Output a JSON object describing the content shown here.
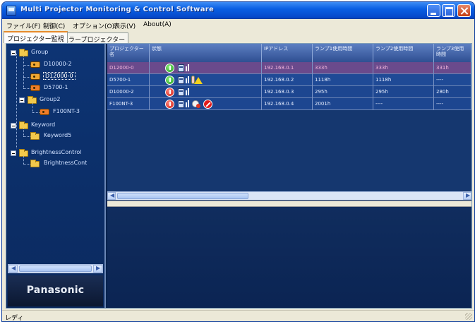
{
  "window": {
    "title": "Multi Projector Monitoring & Control Software"
  },
  "menu": [
    {
      "label": "ファイル(F)"
    },
    {
      "label": "制御(C)"
    },
    {
      "label": "オプション(O)"
    },
    {
      "label": "表示(V)"
    },
    {
      "label": "About(A)"
    }
  ],
  "tabs": [
    {
      "label": "プロジェクター監視",
      "active": true
    },
    {
      "label": "エラープロジェクター",
      "active": false
    }
  ],
  "tree": {
    "group_label": "Group",
    "items": [
      {
        "label": "D10000-2"
      },
      {
        "label": "D12000-0"
      },
      {
        "label": "D5700-1"
      }
    ],
    "group2_label": "Group2",
    "group2_items": [
      {
        "label": "F100NT-3"
      }
    ],
    "keyword_label": "Keyword",
    "keyword_items": [
      {
        "label": "Keyword5"
      }
    ],
    "brightness_label": "BrightnessControl",
    "brightness_items": [
      {
        "label": "BrightnessCont"
      }
    ]
  },
  "brand": {
    "text": "Panasonic"
  },
  "grid": {
    "columns": [
      {
        "label": "プロジェクター名"
      },
      {
        "label": "状態"
      },
      {
        "label": "IPアドレス"
      },
      {
        "label": "ランプ1使用時間"
      },
      {
        "label": "ランプ2使用時間"
      },
      {
        "label": "ランプ3使用時間"
      }
    ],
    "rows": [
      {
        "name": "D12000-0",
        "ip": "192.168.0.1",
        "lamp1": "333h",
        "lamp2": "333h",
        "lamp3": "331h"
      },
      {
        "name": "D5700-1",
        "ip": "192.168.0.2",
        "lamp1": "1118h",
        "lamp2": "1118h",
        "lamp3": "----"
      },
      {
        "name": "D10000-2",
        "ip": "192.168.0.3",
        "lamp1": "295h",
        "lamp2": "295h",
        "lamp3": "280h"
      },
      {
        "name": "F100NT-3",
        "ip": "192.168.0.4",
        "lamp1": "2001h",
        "lamp2": "----",
        "lamp3": "----"
      }
    ]
  },
  "statusbar": {
    "text": "レディ"
  },
  "colors": {
    "selected_row": "#6a4a8c",
    "row": "#1f4a96",
    "power_on": "#1d9b1d",
    "power_off": "#d1170e",
    "titlebar": "#0a5fe3"
  }
}
